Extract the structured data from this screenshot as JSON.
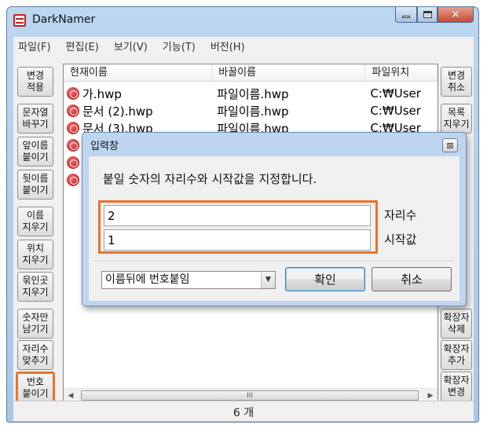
{
  "window": {
    "title": "DarkNamer",
    "minimize": "–",
    "maximize": "□",
    "close": "✕"
  },
  "menu": [
    "파일(F)",
    "편집(E)",
    "보기(V)",
    "기능(T)",
    "버전(H)"
  ],
  "left_buttons": [
    "변경\n적용",
    "문자열\n바꾸기",
    "앞이름\n붙이기",
    "뒷이름\n붙이기",
    "이름\n지우기",
    "위치\n지우기",
    "묶인곳\n지우기",
    "숫자만\n남기기",
    "자리수\n맞추기",
    "번호\n붙이기"
  ],
  "right_buttons": [
    "변경\n취소",
    "목록\n지우기",
    "확장자\n삭제",
    "확장자\n추가",
    "확장자\n변경"
  ],
  "list": {
    "columns": [
      "현재이름",
      "바꿀이름",
      "파일위치"
    ],
    "rows": [
      {
        "current": "가.hwp",
        "new": "파일이름.hwp",
        "location": "C:₩User"
      },
      {
        "current": "문서 (2).hwp",
        "new": "파일이름.hwp",
        "location": "C:₩User"
      },
      {
        "current": "문서 (3).hwp",
        "new": "파일이름.hwp",
        "location": "C:₩User"
      }
    ],
    "scroll_thumb_glyph": "III"
  },
  "status": {
    "count": "6 개"
  },
  "dialog": {
    "title": "입력창",
    "close": "⊠",
    "message": "붙일 숫자의 자리수와 시작값을 지정합니다.",
    "digits_value": "2",
    "digits_label": "자리수",
    "start_value": "1",
    "start_label": "시작값",
    "mode_selected": "이름뒤에 번호붙임",
    "ok_label": "확인",
    "cancel_label": "취소"
  },
  "colors": {
    "highlight": "#e8742a",
    "titlebar": "#bcd7f0"
  }
}
